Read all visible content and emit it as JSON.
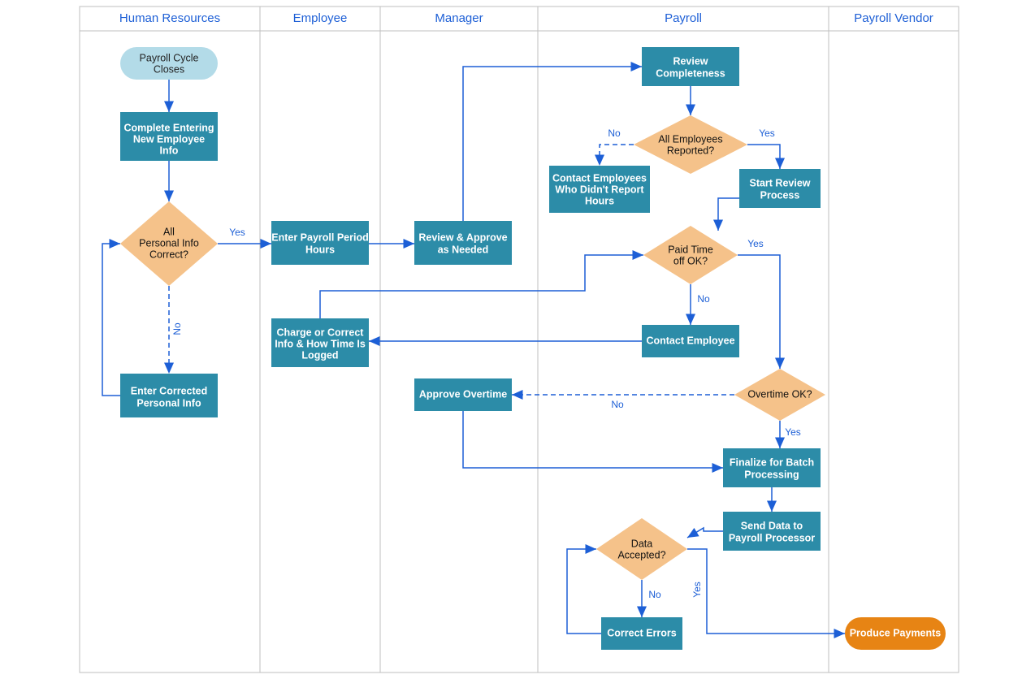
{
  "lanes": {
    "hr": "Human Resources",
    "emp": "Employee",
    "mgr": "Manager",
    "pay": "Payroll",
    "ven": "Payroll Vendor"
  },
  "nodes": {
    "start": [
      "Payroll Cycle",
      "Closes"
    ],
    "completeInfo": [
      "Complete Entering",
      "New Employee",
      "Info"
    ],
    "allPersonal": [
      "All",
      "Personal Info",
      "Correct?"
    ],
    "enterCorrected": [
      "Enter Corrected",
      "Personal Info"
    ],
    "enterPayroll": [
      "Enter Payroll Period",
      "Hours"
    ],
    "reviewApprove": [
      "Review & Approve",
      "as Needed"
    ],
    "chargeCorrect": [
      "Charge or Correct",
      "Info & How Time Is",
      "Logged"
    ],
    "approveOT": [
      "Approve Overtime"
    ],
    "reviewComplete": [
      "Review",
      "Completeness"
    ],
    "allEmp": [
      "All Employees",
      "Reported?"
    ],
    "contactNoReport": [
      "Contact Employees",
      "Who Didn't Report",
      "Hours"
    ],
    "startReview": [
      "Start Review",
      "Process"
    ],
    "paidTime": [
      "Paid Time",
      "off OK?"
    ],
    "contactEmp": [
      "Contact Employee"
    ],
    "overtime": [
      "Overtime OK?"
    ],
    "finalize": [
      "Finalize for Batch",
      "Processing"
    ],
    "sendData": [
      "Send Data to",
      "Payroll Processor"
    ],
    "dataAccepted": [
      "Data",
      "Accepted?"
    ],
    "correctErrors": [
      "Correct Errors"
    ],
    "producePay": [
      "Produce Payments"
    ]
  },
  "labels": {
    "yes": "Yes",
    "no": "No"
  }
}
